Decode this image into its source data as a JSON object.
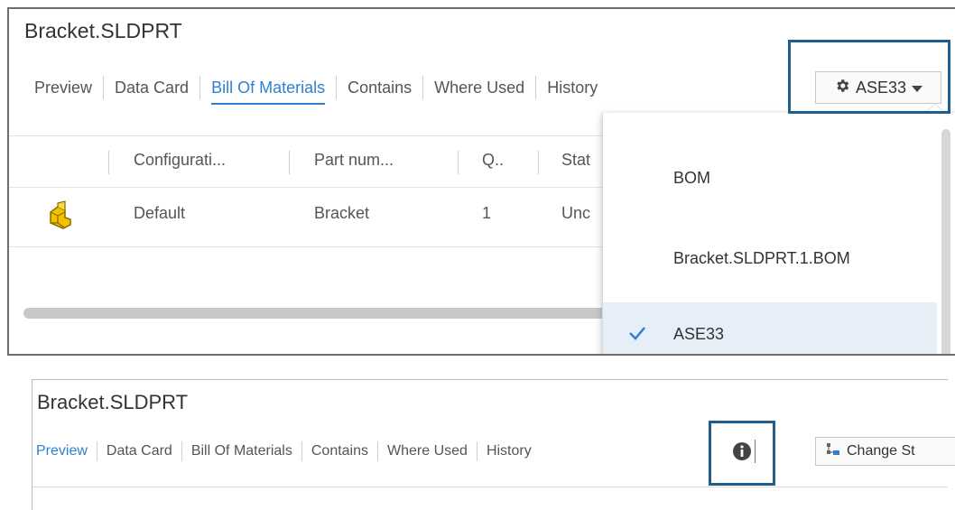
{
  "top": {
    "title": "Bracket.SLDPRT",
    "tabs": [
      "Preview",
      "Data Card",
      "Bill Of Materials",
      "Contains",
      "Where Used",
      "History"
    ],
    "active_tab": "Bill Of Materials",
    "config_button": {
      "icon": "gear-icon",
      "label": "ASE33",
      "caret": "chevron-down-icon"
    },
    "table": {
      "headers": [
        "Configurati...",
        "Part num...",
        "Q..",
        "Stat"
      ],
      "rows": [
        {
          "icon": "part-icon",
          "configuration": "Default",
          "part_number": "Bracket",
          "quantity": "1",
          "status": "Unc"
        }
      ]
    },
    "dropdown": {
      "items": [
        "BOM",
        "Bracket.SLDPRT.1.BOM",
        "ASE33"
      ],
      "selected": "ASE33",
      "check_icon": "checkmark-icon"
    }
  },
  "bottom": {
    "title": "Bracket.SLDPRT",
    "tabs": [
      "Preview",
      "Data Card",
      "Bill Of Materials",
      "Contains",
      "Where Used",
      "History"
    ],
    "active_tab": "Preview",
    "info_icon": "info-icon",
    "change_button": {
      "icon": "change-state-icon",
      "label": "Change St"
    }
  },
  "colors": {
    "accent": "#2f80d1",
    "highlight_box": "#1f5d8c",
    "selected_bg": "#e6eef8"
  }
}
